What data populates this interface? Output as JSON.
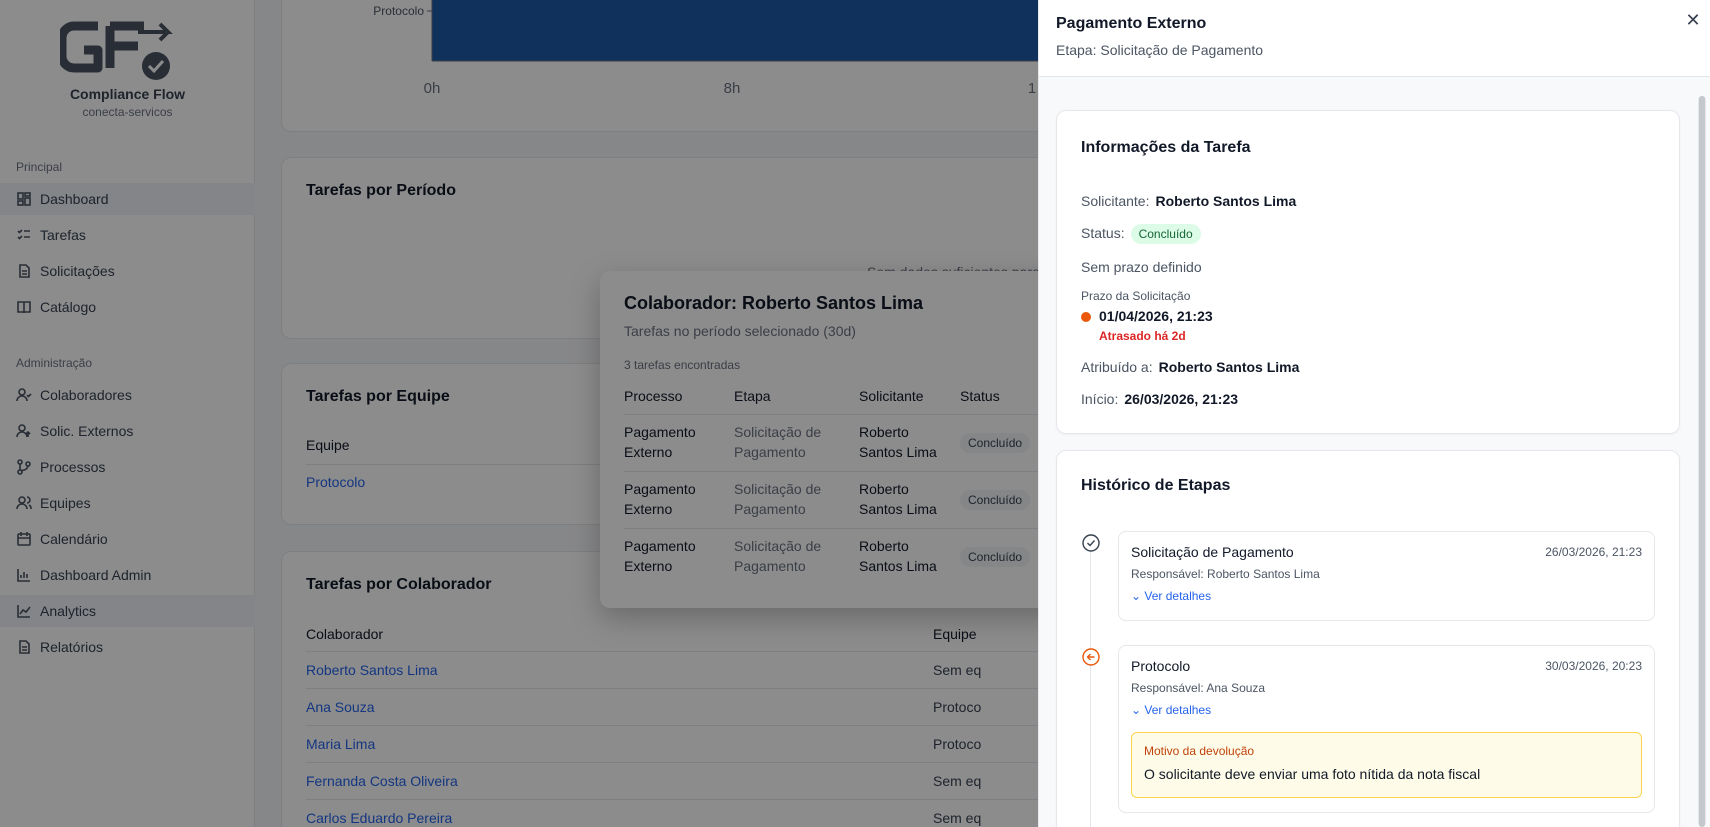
{
  "brand": {
    "name": "Compliance Flow",
    "subtitle": "conecta-servicos"
  },
  "sidebar": {
    "section_main": "Principal",
    "section_admin": "Administração",
    "main_items": [
      {
        "label": "Dashboard",
        "icon": "dashboard-icon"
      },
      {
        "label": "Tarefas",
        "icon": "tasks-icon"
      },
      {
        "label": "Solicitações",
        "icon": "requests-icon"
      },
      {
        "label": "Catálogo",
        "icon": "catalog-icon"
      }
    ],
    "admin_items": [
      {
        "label": "Colaboradores",
        "icon": "users-icon"
      },
      {
        "label": "Solic. Externos",
        "icon": "external-user-icon"
      },
      {
        "label": "Processos",
        "icon": "process-icon"
      },
      {
        "label": "Equipes",
        "icon": "team-icon"
      },
      {
        "label": "Calendário",
        "icon": "calendar-icon"
      },
      {
        "label": "Dashboard Admin",
        "icon": "admin-chart-icon"
      },
      {
        "label": "Analytics",
        "icon": "analytics-icon"
      },
      {
        "label": "Relatórios",
        "icon": "reports-icon"
      }
    ]
  },
  "background": {
    "chart_data": {
      "type": "bar",
      "categories": [
        "Protocolo"
      ],
      "x_ticks": [
        "0h",
        "8h",
        "1"
      ]
    },
    "periodo_card": {
      "title": "Tarefas por Período",
      "empty": "Sem dados suficientes para"
    },
    "equipe_card": {
      "title": "Tarefas por Equipe",
      "col_equipe": "Equipe",
      "rows": [
        "Protocolo"
      ]
    },
    "colaborador_card": {
      "title": "Tarefas por Colaborador",
      "col_colaborador": "Colaborador",
      "col_equipe": "Equipe",
      "rows": [
        {
          "name": "Roberto Santos Lima",
          "team": "Sem eq"
        },
        {
          "name": "Ana Souza",
          "team": "Protoco"
        },
        {
          "name": "Maria Lima",
          "team": "Protoco"
        },
        {
          "name": "Fernanda Costa Oliveira",
          "team": "Sem eq"
        },
        {
          "name": "Carlos Eduardo Pereira",
          "team": "Sem eq"
        }
      ]
    }
  },
  "modal": {
    "title": "Colaborador: Roberto Santos Lima",
    "subtitle": "Tarefas no período selecionado (30d)",
    "count": "3 tarefas encontradas",
    "columns": [
      "Processo",
      "Etapa",
      "Solicitante",
      "Status"
    ],
    "rows": [
      {
        "processo": [
          "Pagamento",
          "Externo"
        ],
        "etapa": [
          "Solicitação de",
          "Pagamento"
        ],
        "solicitante": [
          "Roberto",
          "Santos Lima"
        ],
        "status": "Concluído"
      },
      {
        "processo": [
          "Pagamento",
          "Externo"
        ],
        "etapa": [
          "Solicitação de",
          "Pagamento"
        ],
        "solicitante": [
          "Roberto",
          "Santos Lima"
        ],
        "status": "Concluído"
      },
      {
        "processo": [
          "Pagamento",
          "Externo"
        ],
        "etapa": [
          "Solicitação de",
          "Pagamento"
        ],
        "solicitante": [
          "Roberto",
          "Santos Lima"
        ],
        "status": "Concluído"
      }
    ]
  },
  "drawer": {
    "title": "Pagamento Externo",
    "subtitle": "Etapa: Solicitação de Pagamento",
    "info": {
      "title": "Informações da Tarefa",
      "solicitante_label": "Solicitante:",
      "solicitante": "Roberto Santos Lima",
      "status_label": "Status:",
      "status": "Concluído",
      "prazo_note": "Sem prazo definido",
      "prazo_label": "Prazo da Solicitação",
      "prazo_value": "01/04/2026, 21:23",
      "prazo_late": "Atrasado há 2d",
      "atribuido_label": "Atribuído a:",
      "atribuido": "Roberto Santos Lima",
      "inicio_label": "Início:",
      "inicio": "26/03/2026, 21:23"
    },
    "history": {
      "title": "Histórico de Etapas",
      "steps": [
        {
          "title": "Solicitação de Pagamento",
          "date": "26/03/2026, 21:23",
          "resp": "Responsável: Roberto Santos Lima",
          "link": "Ver detalhes"
        },
        {
          "title": "Protocolo",
          "date": "30/03/2026, 20:23",
          "resp": "Responsável: Ana Souza",
          "link": "Ver detalhes",
          "motivo_label": "Motivo da devolução",
          "motivo_text": "O solicitante deve enviar uma foto nítida da nota fiscal"
        }
      ]
    }
  },
  "colors": {
    "link": "#2563eb",
    "late": "#dc2626",
    "warn_dot": "#ea580c",
    "bar": "#1e5aa8"
  }
}
